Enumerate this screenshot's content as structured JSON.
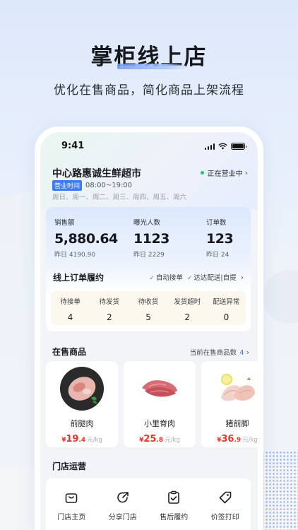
{
  "promo": {
    "headline": "掌柜线上店",
    "subhead": "优化在售商品，简化商品上架流程"
  },
  "status_bar": {
    "time": "9:41"
  },
  "store": {
    "name": "中心路惠诚生鲜超市",
    "status": "正在营业中",
    "hours_tag": "营业时间",
    "hours": "08:00~19:00",
    "weekdays": "周日、周一、周二、周三、周四、周五、周六"
  },
  "stats": [
    {
      "label": "销售额",
      "value": "5,880.64",
      "yesterday": "昨日 4190.90"
    },
    {
      "label": "曝光人数",
      "value": "1123",
      "yesterday": "昨日 2229"
    },
    {
      "label": "订单数",
      "value": "123",
      "yesterday": "昨日 24"
    }
  ],
  "orders": {
    "title": "线上订单履约",
    "option_auto": "自动接单",
    "option_delivery": "达达配送|自提",
    "cells": [
      {
        "label": "待接单",
        "count": "4"
      },
      {
        "label": "待发货",
        "count": "2"
      },
      {
        "label": "待收货",
        "count": "5"
      },
      {
        "label": "发货超时",
        "count": "2"
      },
      {
        "label": "配送异常",
        "count": "0"
      }
    ]
  },
  "goods": {
    "title": "在售商品",
    "count_label": "当前在售商品数",
    "count": "4",
    "items": [
      {
        "name": "前腿肉",
        "currency": "¥",
        "price_int": "19",
        "price_dec": ".4",
        "unit": "元/kg",
        "icon": "pork-leg-image"
      },
      {
        "name": "小里脊肉",
        "currency": "¥",
        "price_int": "25",
        "price_dec": ".8",
        "unit": "元/kg",
        "icon": "tenderloin-image"
      },
      {
        "name": "猪前脚",
        "currency": "¥",
        "price_int": "36",
        "price_dec": ".9",
        "unit": "元/kg",
        "icon": "pig-trotter-image"
      }
    ]
  },
  "operations": {
    "title": "门店运营",
    "items": [
      {
        "label": "门店主页",
        "icon": "shop-bag-icon"
      },
      {
        "label": "分享门店",
        "icon": "share-icon"
      },
      {
        "label": "售后履约",
        "icon": "clipboard-check-icon"
      },
      {
        "label": "价签打印",
        "icon": "price-tag-icon"
      }
    ]
  },
  "colors": {
    "accent": "#3d7bf2",
    "price": "#e8352b",
    "online": "#2bc277"
  }
}
